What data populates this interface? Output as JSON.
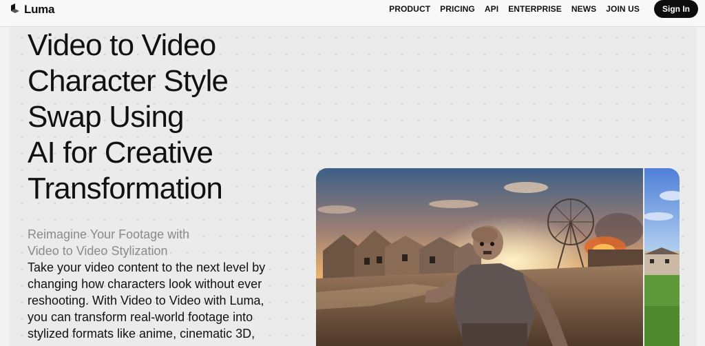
{
  "header": {
    "logo_text": "Luma",
    "nav": [
      {
        "label": "PRODUCT"
      },
      {
        "label": "PRICING"
      },
      {
        "label": "API"
      },
      {
        "label": "ENTERPRISE"
      },
      {
        "label": "NEWS"
      },
      {
        "label": "JOIN US"
      }
    ],
    "signin_label": "Sign In"
  },
  "hero": {
    "title_lines": [
      "Video to Video",
      "Character Style",
      "Swap Using",
      "AI for Creative",
      "Transformation"
    ],
    "subtitle_lines": [
      "Reimagine Your Footage with",
      "Video to Video Stylization"
    ],
    "body": "Take your video content to the next level by changing how characters look without ever reshooting. With Video to Video with Luma, you can transform real-world footage into stylized formats like anime, cinematic 3D,"
  },
  "colors": {
    "accent": "#0d0d0d",
    "background": "#ebebeb",
    "muted_text": "#8a8a8a"
  },
  "icons": {
    "logo": "luma-cube-icon"
  }
}
